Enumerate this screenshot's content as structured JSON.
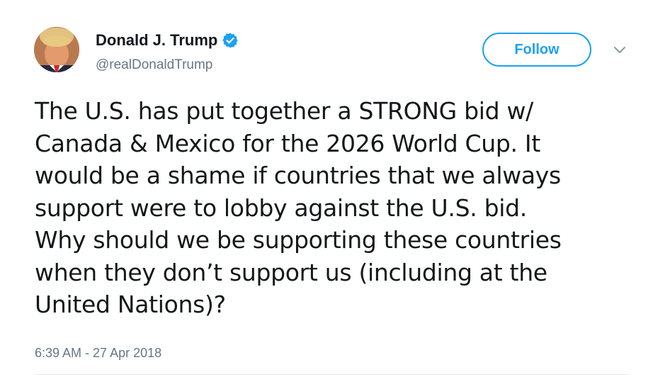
{
  "user": {
    "display_name": "Donald J. Trump",
    "handle": "@realDonaldTrump",
    "verified": true
  },
  "actions": {
    "follow_label": "Follow"
  },
  "tweet": {
    "lines": [
      "The U.S. has put together a STRONG bid w/",
      "Canada & Mexico for the 2026 World Cup. It",
      "would be a shame if countries that we always",
      "support were to lobby against the U.S. bid.",
      "Why should we be supporting these countries",
      "when they don’t support us (including at the",
      "United Nations)?"
    ],
    "timestamp": "6:39 AM - 27 Apr 2018"
  },
  "icons": {
    "verified": "verified-badge-icon",
    "caret": "chevron-down-icon"
  },
  "colors": {
    "accent": "#1da1f2",
    "text": "#14171a",
    "secondary": "#657786"
  }
}
